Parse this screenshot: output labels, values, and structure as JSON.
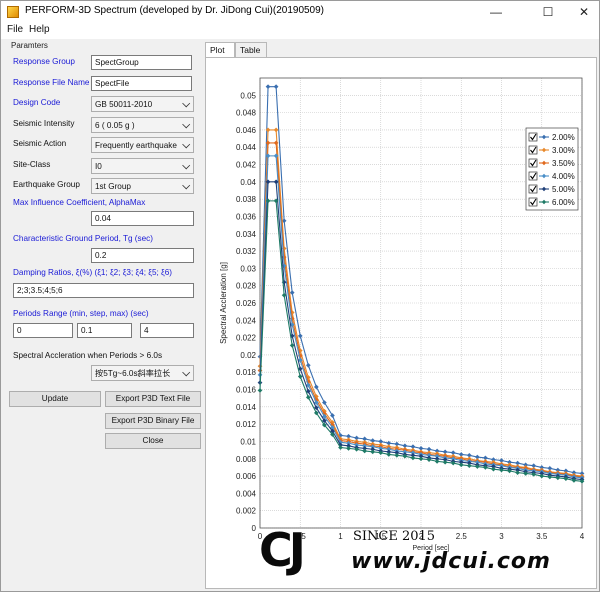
{
  "window": {
    "title": "PERFORM-3D Spectrum (developed by Dr. JiDong Cui)(20190509)",
    "minimize_glyph": "—",
    "maximize_glyph": "☐",
    "close_glyph": "✕"
  },
  "menu": {
    "file": "File",
    "help": "Help"
  },
  "params": {
    "group_title": "Paramters",
    "response_group_label": "Response Group",
    "response_group_value": "SpectGroup",
    "response_file_label": "Response File Name",
    "response_file_value": "SpectFile",
    "design_code_label": "Design Code",
    "design_code_value": "GB 50011-2010",
    "seismic_intensity_label": "Seismic Intensity",
    "seismic_intensity_value": "6 ( 0.05 g )",
    "seismic_action_label": "Seismic Action",
    "seismic_action_value": "Frequently earthquake",
    "site_class_label": "Site-Class",
    "site_class_value": "I0",
    "eq_group_label": "Earthquake Group",
    "eq_group_value": "1st Group",
    "alpha_max_label": "Max Influence Coefficient, AlphaMax",
    "alpha_max_value": "0.04",
    "tg_label": "Characteristic Ground Period, Tg (sec)",
    "tg_value": "0.2",
    "damping_label": "Damping Ratios, ξ(%) (ξ1; ξ2; ξ3; ξ4; ξ5; ξ6)",
    "damping_value": "2;3;3.5;4;5;6",
    "periods_label": "Periods Range (min, step, max) (sec)",
    "period_min": "0",
    "period_step": "0.1",
    "period_max": "4",
    "spectral_label": "Spectral Accleration when Periods > 6.0s",
    "spectral_value": "按5Tg~6.0s斜率拉长"
  },
  "buttons": {
    "update": "Update",
    "export_text": "Export P3D Text File",
    "export_binary": "Export P3D Binary File",
    "close": "Close"
  },
  "tabs": {
    "plot": "Plot",
    "table": "Table"
  },
  "watermark": {
    "logo": "CJ",
    "since": "SINCE 2015",
    "url": "www.jdcui.com"
  },
  "chart_data": {
    "type": "line",
    "xlabel": "Period [sec]",
    "ylabel": "Spectral Accleration [g]",
    "xlim": [
      0,
      4
    ],
    "ylim": [
      0,
      0.052
    ],
    "xticks": [
      0,
      0.5,
      1,
      1.5,
      2,
      2.5,
      3,
      3.5,
      4
    ],
    "xtick_labels": [
      "0",
      "0.5",
      "1",
      "1.5",
      "2",
      "2.5",
      "3",
      "3.5",
      "4"
    ],
    "yticks": [
      0,
      0.002,
      0.004,
      0.006,
      0.008,
      0.01,
      0.012,
      0.014,
      0.016,
      0.018,
      0.02,
      0.022,
      0.024,
      0.026,
      0.028,
      0.03,
      0.032,
      0.034,
      0.036,
      0.038,
      0.04,
      0.042,
      0.044,
      0.046,
      0.048,
      0.05
    ],
    "ytick_labels": [
      "0",
      "0.002",
      "0.004",
      "0.006",
      "0.008",
      "0.01",
      "0.012",
      "0.014",
      "0.016",
      "0.018",
      "0.02",
      "0.022",
      "0.024",
      "0.026",
      "0.028",
      "0.03",
      "0.032",
      "0.034",
      "0.036",
      "0.038",
      "0.04",
      "0.042",
      "0.044",
      "0.046",
      "0.048",
      "0.05"
    ],
    "grid": true,
    "legend_position": "top-right",
    "x": [
      0,
      0.1,
      0.2,
      0.3,
      0.4,
      0.5,
      0.6,
      0.7,
      0.8,
      0.9,
      1.0,
      1.1,
      1.2,
      1.3,
      1.4,
      1.5,
      1.6,
      1.7,
      1.8,
      1.9,
      2.0,
      2.1,
      2.2,
      2.3,
      2.4,
      2.5,
      2.6,
      2.7,
      2.8,
      2.9,
      3.0,
      3.1,
      3.2,
      3.3,
      3.4,
      3.5,
      3.6,
      3.7,
      3.8,
      3.9,
      4.0
    ],
    "series": [
      {
        "name": "2.00%",
        "color": "#3a6fb0",
        "values": [
          0.0198,
          0.051,
          0.051,
          0.0355,
          0.0272,
          0.0222,
          0.0188,
          0.0163,
          0.0145,
          0.013,
          0.0107,
          0.0106,
          0.0104,
          0.0103,
          0.0101,
          0.01,
          0.0098,
          0.0097,
          0.0095,
          0.0094,
          0.0092,
          0.0091,
          0.0089,
          0.0088,
          0.0087,
          0.0085,
          0.0084,
          0.0082,
          0.0081,
          0.0079,
          0.0078,
          0.0076,
          0.0075,
          0.0073,
          0.0072,
          0.007,
          0.0069,
          0.0067,
          0.0066,
          0.0064,
          0.0063
        ]
      },
      {
        "name": "3.00%",
        "color": "#e8882a",
        "values": [
          0.0187,
          0.046,
          0.046,
          0.0323,
          0.0249,
          0.0205,
          0.0174,
          0.0152,
          0.0135,
          0.0122,
          0.0103,
          0.0102,
          0.01,
          0.0099,
          0.0097,
          0.0096,
          0.0094,
          0.0093,
          0.0091,
          0.009,
          0.0088,
          0.0087,
          0.0086,
          0.0084,
          0.0083,
          0.0081,
          0.008,
          0.0078,
          0.0077,
          0.0076,
          0.0074,
          0.0073,
          0.0071,
          0.007,
          0.0068,
          0.0067,
          0.0065,
          0.0064,
          0.0063,
          0.0061,
          0.006
        ]
      },
      {
        "name": "3.50%",
        "color": "#e06a1e",
        "values": [
          0.0182,
          0.0445,
          0.0445,
          0.0313,
          0.0242,
          0.0199,
          0.0169,
          0.0148,
          0.0132,
          0.0119,
          0.0101,
          0.01,
          0.0098,
          0.0097,
          0.0095,
          0.0094,
          0.0092,
          0.0091,
          0.009,
          0.0088,
          0.0087,
          0.0085,
          0.0084,
          0.0083,
          0.0081,
          0.008,
          0.0078,
          0.0077,
          0.0076,
          0.0074,
          0.0073,
          0.0071,
          0.007,
          0.0069,
          0.0067,
          0.0066,
          0.0064,
          0.0063,
          0.0062,
          0.006,
          0.0059
        ]
      },
      {
        "name": "4.00%",
        "color": "#4a8fc8",
        "values": [
          0.0177,
          0.043,
          0.043,
          0.0303,
          0.0235,
          0.0194,
          0.0165,
          0.0145,
          0.0129,
          0.0116,
          0.0099,
          0.0098,
          0.0096,
          0.0095,
          0.0094,
          0.0092,
          0.0091,
          0.0089,
          0.0088,
          0.0087,
          0.0085,
          0.0084,
          0.0083,
          0.0081,
          0.008,
          0.0078,
          0.0077,
          0.0076,
          0.0074,
          0.0073,
          0.0072,
          0.007,
          0.0069,
          0.0067,
          0.0066,
          0.0065,
          0.0063,
          0.0062,
          0.0061,
          0.0059,
          0.0058
        ]
      },
      {
        "name": "5.00%",
        "color": "#1f3f78",
        "values": [
          0.0168,
          0.04,
          0.04,
          0.0284,
          0.0222,
          0.0184,
          0.0158,
          0.0139,
          0.0124,
          0.0112,
          0.0096,
          0.0095,
          0.0093,
          0.0092,
          0.0091,
          0.0089,
          0.0088,
          0.0087,
          0.0085,
          0.0084,
          0.0083,
          0.0081,
          0.008,
          0.0079,
          0.0077,
          0.0076,
          0.0075,
          0.0073,
          0.0072,
          0.0071,
          0.0069,
          0.0068,
          0.0067,
          0.0065,
          0.0064,
          0.0063,
          0.0061,
          0.006,
          0.0059,
          0.0057,
          0.0056
        ]
      },
      {
        "name": "6.00%",
        "color": "#1e7a66",
        "values": [
          0.0159,
          0.0378,
          0.0378,
          0.0269,
          0.0211,
          0.0175,
          0.0151,
          0.0133,
          0.0119,
          0.0108,
          0.0093,
          0.0092,
          0.0091,
          0.0089,
          0.0088,
          0.0087,
          0.0085,
          0.0084,
          0.0083,
          0.0081,
          0.008,
          0.0079,
          0.0077,
          0.0076,
          0.0075,
          0.0073,
          0.0072,
          0.0071,
          0.007,
          0.0068,
          0.0067,
          0.0066,
          0.0064,
          0.0063,
          0.0062,
          0.006,
          0.0059,
          0.0058,
          0.0057,
          0.0055,
          0.0054
        ]
      }
    ]
  }
}
